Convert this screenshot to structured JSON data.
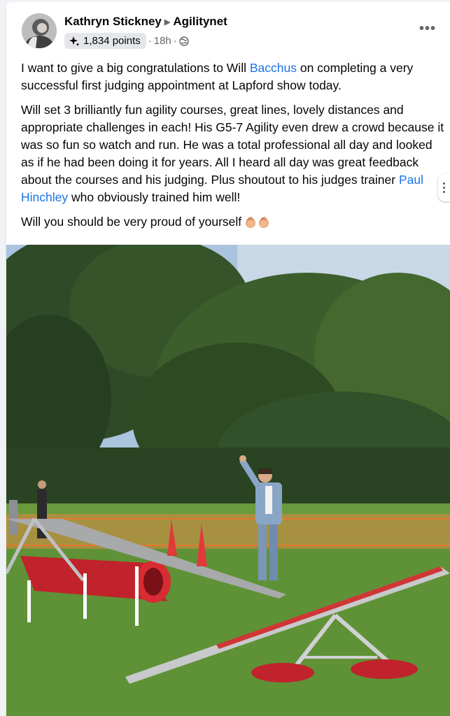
{
  "post": {
    "author": "Kathryn Stickney",
    "group": "Agilitynet",
    "points": "1,834 points",
    "time": "18h",
    "more_label": "•••",
    "paragraphs": [
      {
        "before": "I want to give a big congratulations to Will ",
        "link": "Bacchus",
        "after": " on completing a very successful first judging appointment at Lapford show today."
      },
      {
        "before": "Will set 3 brilliantly fun agility courses, great lines, lovely distances and appropriate challenges in each! His G5-7 Agility even drew a crowd because it was so fun so watch and run. He was a total professional all day and looked as if he had been doing it for years. All I heard all day was great feedback about the courses and his judging. Plus shoutout to his judges trainer ",
        "link": "Paul Hinchley",
        "after": " who obviously trained him well!"
      },
      {
        "before": "Will you should be very proud of yourself",
        "link": "",
        "after": ""
      }
    ],
    "emoji": "clapping-hands-icon"
  },
  "colors": {
    "link": "#1b74e4",
    "secondary_text": "#65676b",
    "badge_bg": "#e4e6eb",
    "card_bg": "#ffffff",
    "page_bg": "#f0f2f5"
  }
}
